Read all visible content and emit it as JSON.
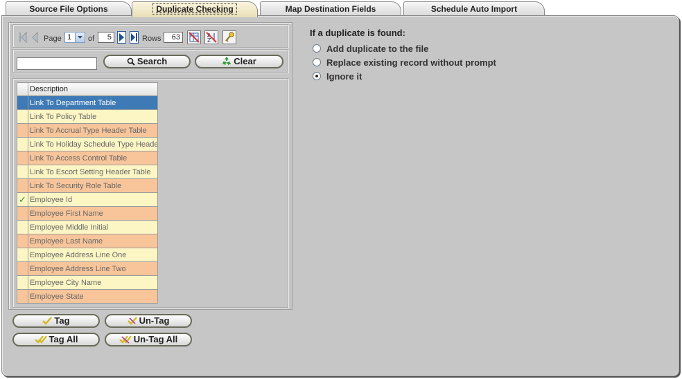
{
  "tabs": [
    {
      "label": "Source File Options",
      "active": false
    },
    {
      "label": "Duplicate Checking",
      "active": true
    },
    {
      "label": "Map Destination Fields",
      "active": false
    },
    {
      "label": "Schedule Auto Import",
      "active": false
    }
  ],
  "pager": {
    "page_label": "Page",
    "page_value": "1",
    "of_label": "of",
    "total_pages": "5",
    "rows_label": "Rows",
    "rows_value": "63"
  },
  "search": {
    "input_value": "",
    "search_label": "Search",
    "clear_label": "Clear"
  },
  "grid": {
    "header": "Description",
    "rows": [
      {
        "desc": "Link To Department Table",
        "checked": false,
        "selected": true
      },
      {
        "desc": "Link To Policy Table",
        "checked": false
      },
      {
        "desc": "Link To Accrual Type Header Table",
        "checked": false
      },
      {
        "desc": "Link To Holiday Schedule Type Header",
        "checked": false
      },
      {
        "desc": "Link To Access Control Table",
        "checked": false
      },
      {
        "desc": "Link To Escort Setting Header Table",
        "checked": false
      },
      {
        "desc": "Link To Security Role Table",
        "checked": false
      },
      {
        "desc": "Employee Id",
        "checked": true
      },
      {
        "desc": "Employee First Name",
        "checked": false
      },
      {
        "desc": "Employee Middle Initial",
        "checked": false
      },
      {
        "desc": "Employee Last Name",
        "checked": false
      },
      {
        "desc": "Employee Address Line One",
        "checked": false
      },
      {
        "desc": "Employee Address Line Two",
        "checked": false
      },
      {
        "desc": "Employee City Name",
        "checked": false
      },
      {
        "desc": "Employee State",
        "checked": false
      }
    ]
  },
  "tag_buttons": {
    "tag": "Tag",
    "untag": "Un-Tag",
    "tag_all": "Tag All",
    "untag_all": "Un-Tag All"
  },
  "duplicate": {
    "question": "If a duplicate is found:",
    "options": [
      {
        "label": "Add duplicate to the file",
        "checked": false
      },
      {
        "label": "Replace existing record without prompt",
        "checked": false
      },
      {
        "label": "Ignore it",
        "checked": true
      }
    ]
  },
  "colors": {
    "row_odd": "#fcf5c4",
    "row_even": "#f8c59b",
    "row_selected": "#3e7ab6",
    "check_mark": "#2f8f2f"
  }
}
